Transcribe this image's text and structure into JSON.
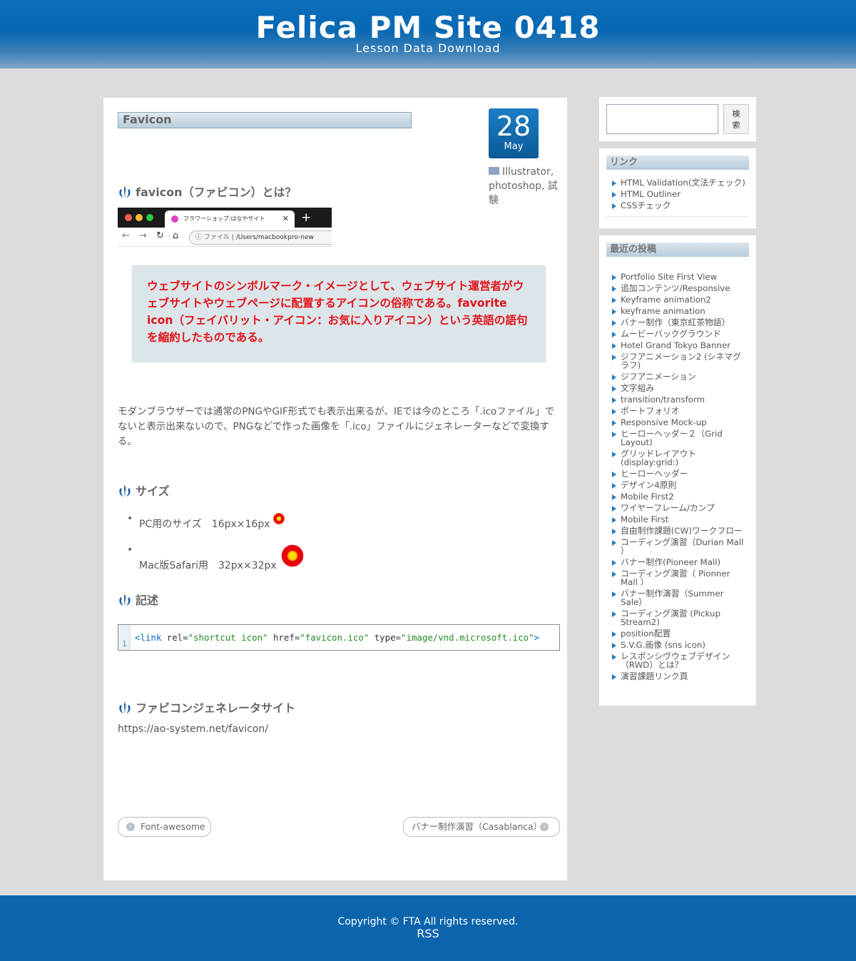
{
  "header": {
    "site_title": "Felica PM Site 0418",
    "site_description": "Lesson Data Download"
  },
  "post": {
    "title": "Favicon",
    "date_day": "28",
    "date_month": "May",
    "categories": "Illustrator, photoshop, 試験",
    "section1_heading": "favicon（ファビコン）とは？",
    "browser_tab_title": "フラワーショップ:はなやサイト",
    "browser_url_label": "ファイル",
    "browser_url_path": "/Users/macbookpro-new",
    "quote": "ウェブサイトのシンボルマーク・イメージとして、ウェブサイト運営者がウェブサイトやウェブページに配置するアイコンの俗称である。favorite icon（フェイバリット・アイコン：お気に入りアイコン）という英語の語句を縮約したものである。",
    "paragraph": "モダンブラウザーでは通常のPNGやGIF形式でも表示出来るが、IEでは今のところ「.icoファイル」でないと表示出来ないので、PNGなどで作った画像を「.ico」ファイルにジェネレーターなどで変換する。",
    "size_heading": "サイズ",
    "sizes": [
      {
        "label": "PC用のサイズ　16px×16px"
      },
      {
        "label": "Mac版Safari用　32px×32px"
      }
    ],
    "code_heading": "記述",
    "code_line_number": "1",
    "code": {
      "open": "<link ",
      "attr1": "rel=",
      "val1": "\"shortcut icon\"",
      "attr2": " href=",
      "val2": "\"favicon.ico\"",
      "attr3": " type=",
      "val3": "\"image/vnd.microsoft.ico\"",
      "close": ">"
    },
    "generator_heading": "ファビコンジェネレータサイト",
    "generator_url": "https://ao-system.net/favicon/",
    "prev_post": "Font-awesome",
    "next_post": "バナー制作演習（Casablanca）"
  },
  "sidebar": {
    "search_button": "検索",
    "links_title": "リンク",
    "links": [
      {
        "label": "HTML Validation(文法チェック)"
      },
      {
        "label": "HTML Outliner"
      },
      {
        "label": "CSSチェック"
      }
    ],
    "recent_title": "最近の投稿",
    "recent": [
      {
        "l1": "Portfolio Site First View",
        "l2": ""
      },
      {
        "l1": "追加コンテンツ/Responsive",
        "l2": ""
      },
      {
        "l1": "Keyframe animation2",
        "l2": ""
      },
      {
        "l1": "keyframe animation",
        "l2": ""
      },
      {
        "l1": "バナー制作（東京紅茶物語）",
        "l2": ""
      },
      {
        "l1": "ムービーバックグラウンド",
        "l2": ""
      },
      {
        "l1": "Hotel Grand Tokyo Banner",
        "l2": ""
      },
      {
        "l1": "ジフアニメーション2 (シネマグ",
        "l2": "ラフ)"
      },
      {
        "l1": "ジフアニメーション",
        "l2": ""
      },
      {
        "l1": "文字組み",
        "l2": ""
      },
      {
        "l1": "transition/transform",
        "l2": ""
      },
      {
        "l1": "ポートフォリオ",
        "l2": ""
      },
      {
        "l1": "Responsive Mock-up",
        "l2": ""
      },
      {
        "l1": "ヒーローヘッダー２（Grid",
        "l2": "Layout)"
      },
      {
        "l1": "グリッドレイアウト",
        "l2": "(display:grid:)"
      },
      {
        "l1": "ヒーローヘッダー",
        "l2": ""
      },
      {
        "l1": "デザイン4原則",
        "l2": ""
      },
      {
        "l1": "Mobile First2",
        "l2": ""
      },
      {
        "l1": "ワイヤーフレーム/カンプ",
        "l2": ""
      },
      {
        "l1": "Mobile First",
        "l2": ""
      },
      {
        "l1": "自由制作課題(CW)ワークフロー",
        "l2": ""
      },
      {
        "l1": "コーディング演習（Durian Mall",
        "l2": "）"
      },
      {
        "l1": "バナー制作(Pioneer Mall)",
        "l2": ""
      },
      {
        "l1": "コーディング演習（ Pionner",
        "l2": "Mall ）"
      },
      {
        "l1": "バナー制作演習（Summer",
        "l2": "Sale）"
      },
      {
        "l1": "コーディング演習 (Pickup",
        "l2": "Stream2)"
      },
      {
        "l1": "position配置",
        "l2": ""
      },
      {
        "l1": "S.V.G.画像 (sns icon)",
        "l2": ""
      },
      {
        "l1": "レスポンシヴウェブデザイン",
        "l2": "（RWD）とは？"
      },
      {
        "l1": "演習課題リンク頁",
        "l2": ""
      }
    ]
  },
  "footer": {
    "copyright": "Copyright © FTA All rights reserved.",
    "rss": "RSS"
  },
  "colors": {
    "header_blue": "#0a6fbc",
    "footer_blue": "#0c65ac",
    "quote_red": "#e3141b",
    "date_badge": "#1a7ec6"
  }
}
